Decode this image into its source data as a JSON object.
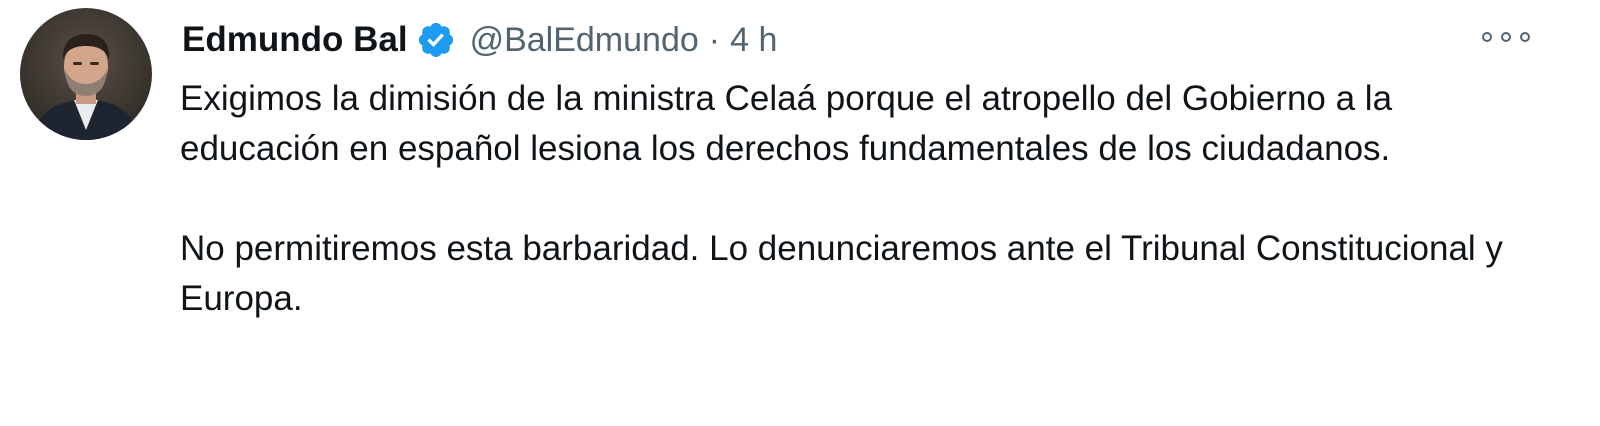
{
  "tweet": {
    "author": {
      "display_name": "Edmundo Bal",
      "handle": "@BalEdmundo",
      "verified": true,
      "avatar_icon": "profile-photo"
    },
    "separator": "·",
    "timestamp": "4 h",
    "more_icon": "more-options-icon",
    "paragraphs": [
      "Exigimos la dimisión de la ministra Celaá porque el atropello del Gobierno a la educación en español lesiona los derechos fundamentales de los ciudadanos.",
      "No permitiremos esta barbaridad. Lo denunciaremos ante el Tribunal Constitucional y Europa."
    ]
  },
  "colors": {
    "text_primary": "#0f1419",
    "text_secondary": "#536471",
    "verified_blue": "#1d9bf0",
    "background": "#ffffff"
  }
}
